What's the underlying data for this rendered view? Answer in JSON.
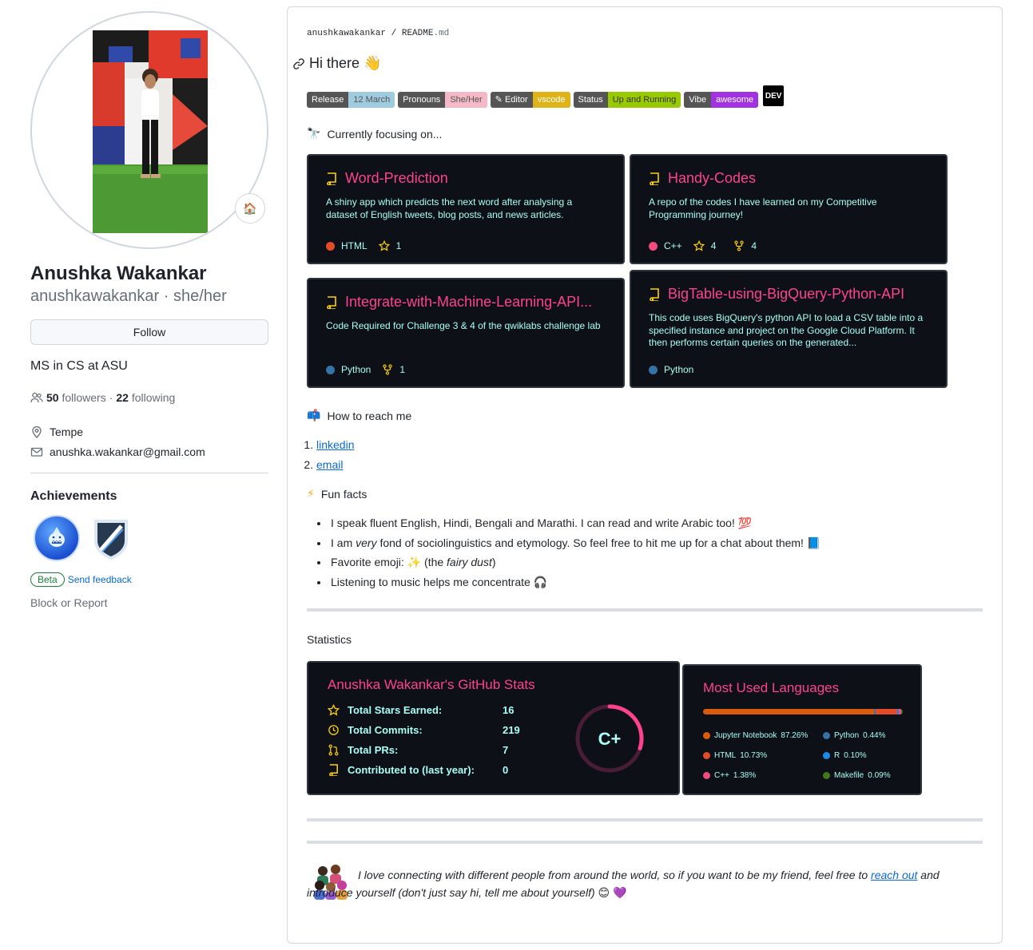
{
  "profile": {
    "fullname": "Anushka Wakankar",
    "username": "anushkawakankar",
    "pronouns": "she/her",
    "separator": "·",
    "follow_label": "Follow",
    "bio": "MS in CS at ASU",
    "followers_count": "50",
    "followers_label": "followers",
    "following_count": "22",
    "following_label": "following",
    "dot": "·",
    "location": "Tempe",
    "email": "anushka.wakankar@gmail.com",
    "status_emoji": "🏠",
    "achievements_title": "Achievements",
    "beta_label": "Beta",
    "feedback_label": "Send feedback",
    "block_label": "Block or Report"
  },
  "readme": {
    "crumb_user": "anushkawakankar",
    "crumb_sep": "/",
    "crumb_file": "README",
    "crumb_ext": ".md",
    "greeting": "Hi there",
    "greeting_emoji": "👋",
    "shields": [
      {
        "label": "Release",
        "value": "12 March",
        "color": "#9ecbdd",
        "text": "#555555"
      },
      {
        "label": "Pronouns",
        "value": "She/Her",
        "color": "#f4b8c6",
        "text": "#555555"
      },
      {
        "label": "✎ Editor",
        "value": "vscode",
        "color": "#dfb317",
        "text": "#ffffff"
      },
      {
        "label": "Status",
        "value": "Up and Running",
        "color": "#97ca00",
        "text": "#333333"
      },
      {
        "label": "Vibe",
        "value": "awesome",
        "color": "#a032e0",
        "text": "#ffffff"
      }
    ],
    "dev_badge": "DEV",
    "focus_title": "Currently focusing on...",
    "focus_icon": "🔭",
    "pins": [
      {
        "name": "Word-Prediction",
        "desc": "A shiny app which predicts the next word after analysing a dataset of English tweets, blog posts, and news articles.",
        "lang": "HTML",
        "lang_color": "#e34c26",
        "stars": "1",
        "forks": ""
      },
      {
        "name": "Handy-Codes",
        "desc": "A repo of the codes I have learned on my Competitive Programming journey!",
        "lang": "C++",
        "lang_color": "#f34b7d",
        "stars": "4",
        "forks": "4"
      },
      {
        "name": "Integrate-with-Machine-Learning-API...",
        "desc": "Code Required for Challenge 3 & 4 of the qwiklabs challenge lab",
        "lang": "Python",
        "lang_color": "#3572A5",
        "stars": "",
        "forks": "1"
      },
      {
        "name": "BigTable-using-BigQuery-Python-API",
        "desc": "This code uses BigQuery's python API to load a CSV table into a specified instance and project on the Google Cloud Platform. It then performs certain queries on the generated...",
        "lang": "Python",
        "lang_color": "#3572A5",
        "stars": "",
        "forks": ""
      }
    ],
    "reach_title": "How to reach me",
    "reach_icon": "📫",
    "reach_links": [
      "linkedin",
      "email"
    ],
    "fun_title": "Fun facts",
    "fun_icon": "⚡",
    "facts": {
      "f1": "I speak fluent English, Hindi, Bengali and Marathi. I can read and write Arabic too!",
      "f1_emoji": "💯",
      "f2_a": "I am",
      "f2_em": "very",
      "f2_b": "fond of sociolinguistics and etymology. So feel free to hit me up for a chat about them!",
      "f2_emoji": "📘",
      "f3_a": "Favorite emoji:",
      "f3_emoji": "✨",
      "f3_b": "(the",
      "f3_em": "fairy dust",
      "f3_c": ")",
      "f4": "Listening to music helps me concentrate",
      "f4_emoji": "🎧"
    },
    "statistics_title": "Statistics",
    "stats": {
      "title": "Anushka Wakankar's GitHub Stats",
      "rows": [
        {
          "label": "Total Stars Earned:",
          "value": "16"
        },
        {
          "label": "Total Commits:",
          "value": "219"
        },
        {
          "label": "Total PRs:",
          "value": "7"
        },
        {
          "label": "Contributed to (last year):",
          "value": "0"
        }
      ],
      "grade": "C+",
      "grade_progress": 0.3
    },
    "languages": {
      "title": "Most Used Languages",
      "items": [
        {
          "name": "Jupyter Notebook",
          "pct": "87.26%",
          "value": 87.26,
          "color": "#DA5B0B"
        },
        {
          "name": "Python",
          "pct": "0.44%",
          "value": 0.44,
          "color": "#3572A5"
        },
        {
          "name": "HTML",
          "pct": "10.73%",
          "value": 10.73,
          "color": "#e34c26"
        },
        {
          "name": "R",
          "pct": "0.10%",
          "value": 0.1,
          "color": "#198CE7"
        },
        {
          "name": "C++",
          "pct": "1.38%",
          "value": 1.38,
          "color": "#f34b7d"
        },
        {
          "name": "Makefile",
          "pct": "0.09%",
          "value": 0.09,
          "color": "#427819"
        }
      ]
    },
    "footer": {
      "text_a": "I love connecting with different people from around the world, so if you want to be my friend, feel free to",
      "link": "reach out",
      "text_b": "and introduce yourself (don't just say hi, tell me about yourself)",
      "emoji_1": "😊",
      "emoji_2": "💜"
    }
  }
}
